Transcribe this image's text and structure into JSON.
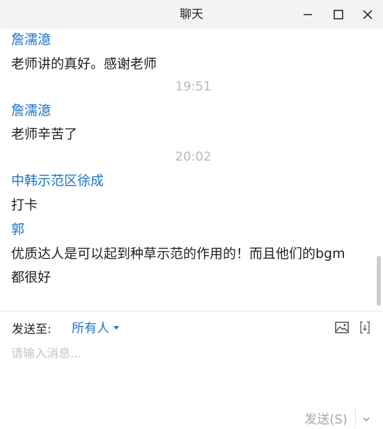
{
  "window": {
    "title": "聊天"
  },
  "messages": [
    {
      "sender": "詹濡澺",
      "text": "老师讲的真好。感谢老师"
    },
    {
      "timestamp": "19:51"
    },
    {
      "sender": "詹濡澺",
      "text": "老师辛苦了"
    },
    {
      "timestamp": "20:02"
    },
    {
      "sender": "中韩示范区徐成",
      "text": "打卡"
    },
    {
      "sender": "郭",
      "text_lines": [
        "优质达人是可以起到种草示范的作用的！而且他们的bgm",
        "都很好"
      ]
    }
  ],
  "compose": {
    "send_to_label": "发送至:",
    "recipient": "所有人",
    "input_placeholder": "请输入消息...",
    "input_value": "",
    "send_label": "发送(S)"
  },
  "icons": {
    "minimize": "minimize-icon",
    "maximize": "maximize-icon",
    "close": "close-icon",
    "image": "image-icon",
    "screenshot": "screenshot-icon",
    "send_options": "chevron-down-icon",
    "recipient_dropdown": "caret-down-icon"
  },
  "colors": {
    "accent": "#1a73c9",
    "timestamp": "#b8b8b8",
    "placeholder": "#c4c4c4",
    "send_disabled": "#a6a6a6",
    "titlebar": "#f3f3f3"
  }
}
